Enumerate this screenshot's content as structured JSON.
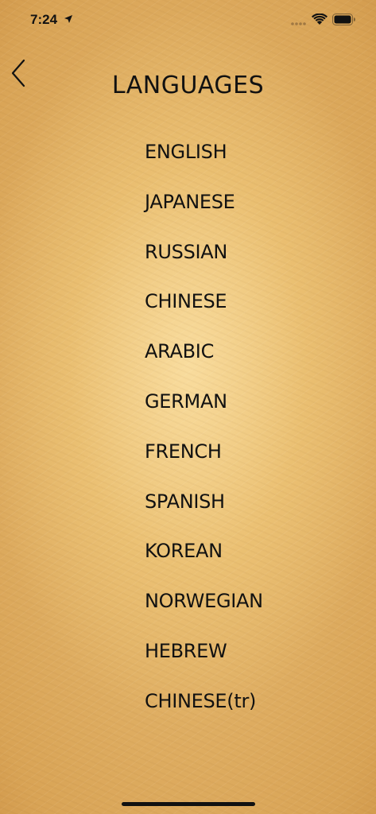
{
  "status_bar": {
    "time": "7:24",
    "icons": [
      "location-arrow-icon",
      "signal-dots-icon",
      "wifi-icon",
      "battery-icon"
    ]
  },
  "header": {
    "back_icon": "chevron-left-icon",
    "title": "LANGUAGES"
  },
  "languages": [
    "ENGLISH",
    "JAPANESE",
    "RUSSIAN",
    "CHINESE",
    "ARABIC",
    "GERMAN",
    "FRENCH",
    "SPANISH",
    "KOREAN",
    "NORWEGIAN",
    "HEBREW",
    "CHINESE(tr)"
  ],
  "colors": {
    "paper_center": "#f6d796",
    "paper_edge": "#a9682a",
    "text": "#111111"
  }
}
